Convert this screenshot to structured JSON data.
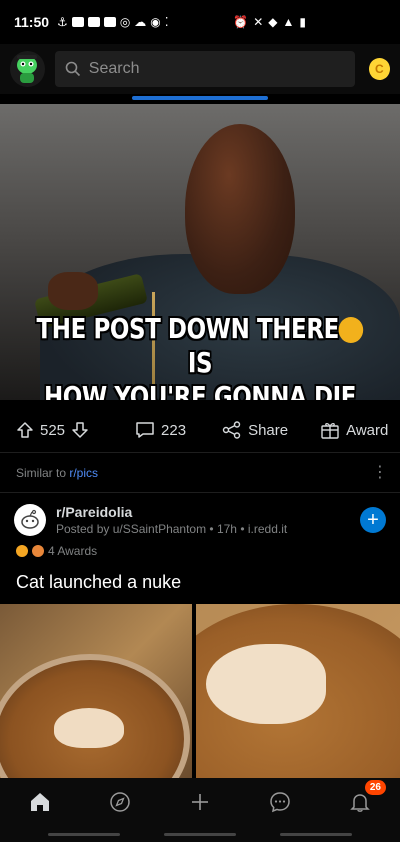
{
  "status_bar": {
    "time": "11:50"
  },
  "header": {
    "search_placeholder": "Search",
    "coin_label": "C"
  },
  "post": {
    "caption_line1_a": "THE POST DOWN THERE",
    "caption_line1_b": "IS",
    "caption_line2": "HOW YOU'RE GONNA DIE",
    "votes": "525",
    "comments": "223",
    "share_label": "Share",
    "award_label": "Award"
  },
  "similar": {
    "prefix": "Similar to ",
    "subreddit": "r/pics",
    "post": {
      "subreddit": "r/Pareidolia",
      "byline": "Posted by u/SSaintPhantom • 17h • i.redd.it",
      "awards": "4 Awards",
      "title": "Cat launched a nuke"
    }
  },
  "bottom_nav": {
    "notification_count": "26"
  },
  "colors": {
    "accent": "#0079d3",
    "badge": "#ff4500",
    "coin": "#ffd635"
  }
}
